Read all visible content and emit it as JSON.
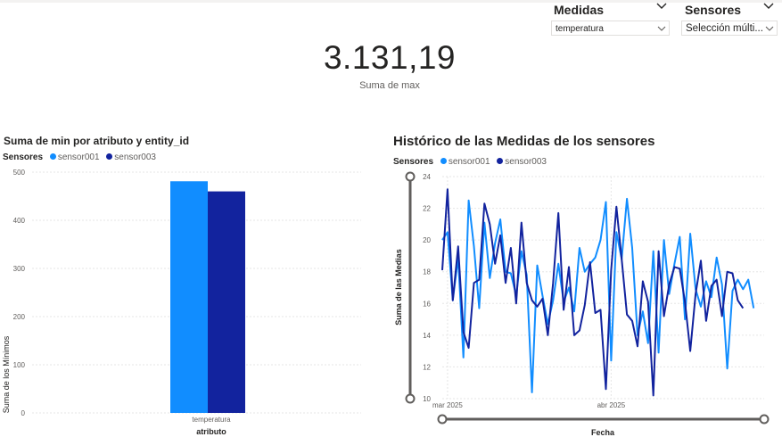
{
  "slicers": {
    "medidas": {
      "title": "Medidas",
      "value": "temperatura"
    },
    "sensores": {
      "title": "Sensores",
      "value": "Selección múlti..."
    }
  },
  "kpi": {
    "value": "3.131,19",
    "label": "Suma de max"
  },
  "colors": {
    "sensor001": "#118dff",
    "sensor003": "#12239e"
  },
  "bar_chart": {
    "title": "Suma de min por atributo y entity_id",
    "legend_title": "Sensores",
    "legend": [
      "sensor001",
      "sensor003"
    ],
    "y_label": "Suma de los Mínimos",
    "x_label": "atributo"
  },
  "line_chart": {
    "title": "Histórico de las Medidas de los sensores",
    "legend_title": "Sensores",
    "legend": [
      "sensor001",
      "sensor003"
    ],
    "y_label": "Suma de las Medias",
    "x_label": "Fecha"
  },
  "chart_data": [
    {
      "type": "bar",
      "title": "Suma de min por atributo y entity_id",
      "categories": [
        "temperatura"
      ],
      "series": [
        {
          "name": "sensor001",
          "values": [
            481
          ]
        },
        {
          "name": "sensor003",
          "values": [
            460
          ]
        }
      ],
      "xlabel": "atributo",
      "ylabel": "Suma de los Mínimos",
      "ylim": [
        0,
        500
      ],
      "yticks": [
        0,
        100,
        200,
        300,
        400,
        500
      ],
      "grid": true,
      "legend_position": "top-left"
    },
    {
      "type": "line",
      "title": "Histórico de las Medidas de los sensores",
      "x": [
        "2025-02-28",
        "2025-03-01",
        "2025-03-02",
        "2025-03-03",
        "2025-03-04",
        "2025-03-05",
        "2025-03-06",
        "2025-03-07",
        "2025-03-08",
        "2025-03-09",
        "2025-03-10",
        "2025-03-11",
        "2025-03-12",
        "2025-03-13",
        "2025-03-14",
        "2025-03-15",
        "2025-03-16",
        "2025-03-17",
        "2025-03-18",
        "2025-03-19",
        "2025-03-20",
        "2025-03-21",
        "2025-03-22",
        "2025-03-23",
        "2025-03-24",
        "2025-03-25",
        "2025-03-26",
        "2025-03-27",
        "2025-03-28",
        "2025-03-29",
        "2025-03-30",
        "2025-03-31",
        "2025-04-01",
        "2025-04-02",
        "2025-04-03",
        "2025-04-04",
        "2025-04-05",
        "2025-04-06",
        "2025-04-07",
        "2025-04-08",
        "2025-04-09",
        "2025-04-10",
        "2025-04-11",
        "2025-04-12",
        "2025-04-13",
        "2025-04-14",
        "2025-04-15",
        "2025-04-16",
        "2025-04-17",
        "2025-04-18",
        "2025-04-19",
        "2025-04-20",
        "2025-04-21",
        "2025-04-22",
        "2025-04-23",
        "2025-04-24",
        "2025-04-25",
        "2025-04-26",
        "2025-04-27",
        "2025-04-28",
        "2025-04-29",
        "2025-04-30"
      ],
      "series": [
        {
          "name": "sensor001",
          "values": [
            20.0,
            20.5,
            16.2,
            18.9,
            12.6,
            22.5,
            19.6,
            15.7,
            21.1,
            17.6,
            19.8,
            21.3,
            18.0,
            17.9,
            16.5,
            19.3,
            17.8,
            10.4,
            18.4,
            16.5,
            14.7,
            16.2,
            18.5,
            16.1,
            17.0,
            15.5,
            19.5,
            18.0,
            18.5,
            18.9,
            20.0,
            22.4,
            12.4,
            20.5,
            18.8,
            22.6,
            19.5,
            14.0,
            15.5,
            13.5,
            19.3,
            12.9,
            20.0,
            16.6,
            18.5,
            20.2,
            15.0,
            20.4,
            16.9,
            15.8,
            17.4,
            16.4,
            18.9,
            17.2,
            11.9,
            16.8,
            17.5,
            16.9,
            17.5,
            15.7,
            0,
            0
          ]
        },
        {
          "name": "sensor003",
          "values": [
            18.1,
            23.2,
            16.2,
            19.6,
            14.2,
            13.2,
            17.3,
            17.5,
            22.3,
            21.0,
            18.5,
            20.3,
            17.3,
            19.5,
            16.0,
            21.1,
            17.3,
            16.2,
            15.8,
            16.3,
            14.0,
            17.3,
            21.7,
            15.6,
            18.3,
            14.0,
            14.3,
            15.9,
            18.6,
            15.4,
            15.6,
            10.6,
            18.1,
            22.1,
            18.8,
            15.3,
            14.9,
            13.3,
            17.4,
            16.1,
            10.2,
            19.3,
            15.2,
            17.2,
            18.3,
            18.2,
            16.1,
            13.0,
            16.6,
            18.7,
            14.9,
            17.1,
            17.5,
            15.2,
            18.0,
            17.9,
            16.2,
            15.7,
            0,
            0,
            0,
            0
          ]
        }
      ],
      "xticks": [
        "mar 2025",
        "abr 2025"
      ],
      "xlabel": "Fecha",
      "ylabel": "Suma de las Medias",
      "ylim": [
        10,
        24
      ],
      "yticks": [
        10,
        12,
        14,
        16,
        18,
        20,
        22,
        24
      ],
      "grid": true,
      "legend_position": "top-left"
    }
  ]
}
